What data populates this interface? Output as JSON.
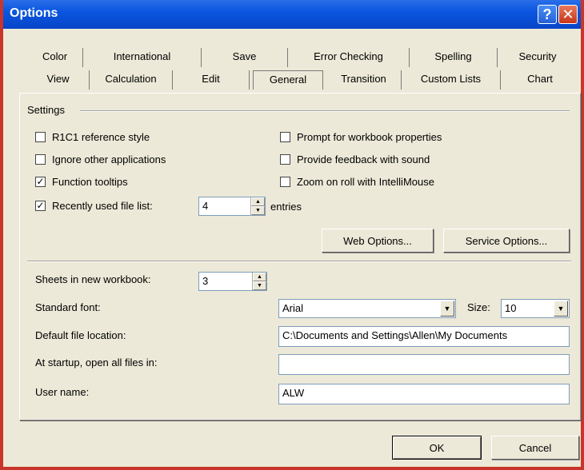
{
  "window": {
    "title": "Options"
  },
  "tabs_row1": [
    {
      "label": "Color"
    },
    {
      "label": "International"
    },
    {
      "label": "Save"
    },
    {
      "label": "Error Checking"
    },
    {
      "label": "Spelling"
    },
    {
      "label": "Security"
    }
  ],
  "tabs_row2": [
    {
      "label": "View"
    },
    {
      "label": "Calculation"
    },
    {
      "label": "Edit"
    },
    {
      "label": "General"
    },
    {
      "label": "Transition"
    },
    {
      "label": "Custom Lists"
    },
    {
      "label": "Chart"
    }
  ],
  "active_tab": "General",
  "settings": {
    "group_label": "Settings",
    "checkboxes_left": [
      {
        "label": "R1C1 reference style",
        "checked": false
      },
      {
        "label": "Ignore other applications",
        "checked": false
      },
      {
        "label": "Function tooltips",
        "checked": true
      },
      {
        "label": "Recently used file list:",
        "checked": true
      }
    ],
    "checkboxes_right": [
      {
        "label": "Prompt for workbook properties",
        "checked": false
      },
      {
        "label": "Provide feedback with sound",
        "checked": false
      },
      {
        "label": "Zoom on roll with IntelliMouse",
        "checked": false
      }
    ],
    "recent_files_count": "4",
    "entries_label": "entries",
    "web_options_label": "Web Options...",
    "service_options_label": "Service Options..."
  },
  "fields": {
    "sheets_label": "Sheets in new workbook:",
    "sheets_value": "3",
    "font_label": "Standard font:",
    "font_value": "Arial",
    "size_label": "Size:",
    "size_value": "10",
    "location_label": "Default file location:",
    "location_value": "C:\\Documents and Settings\\Allen\\My Documents",
    "startup_label": "At startup, open all files in:",
    "startup_value": "",
    "username_label": "User name:",
    "username_value": "ALW"
  },
  "buttons": {
    "ok": "OK",
    "cancel": "Cancel"
  },
  "check_mark": "✓",
  "icons": {
    "help": "?",
    "close": "✕",
    "spin_up": "▲",
    "spin_down": "▼",
    "dropdown": "▼"
  }
}
